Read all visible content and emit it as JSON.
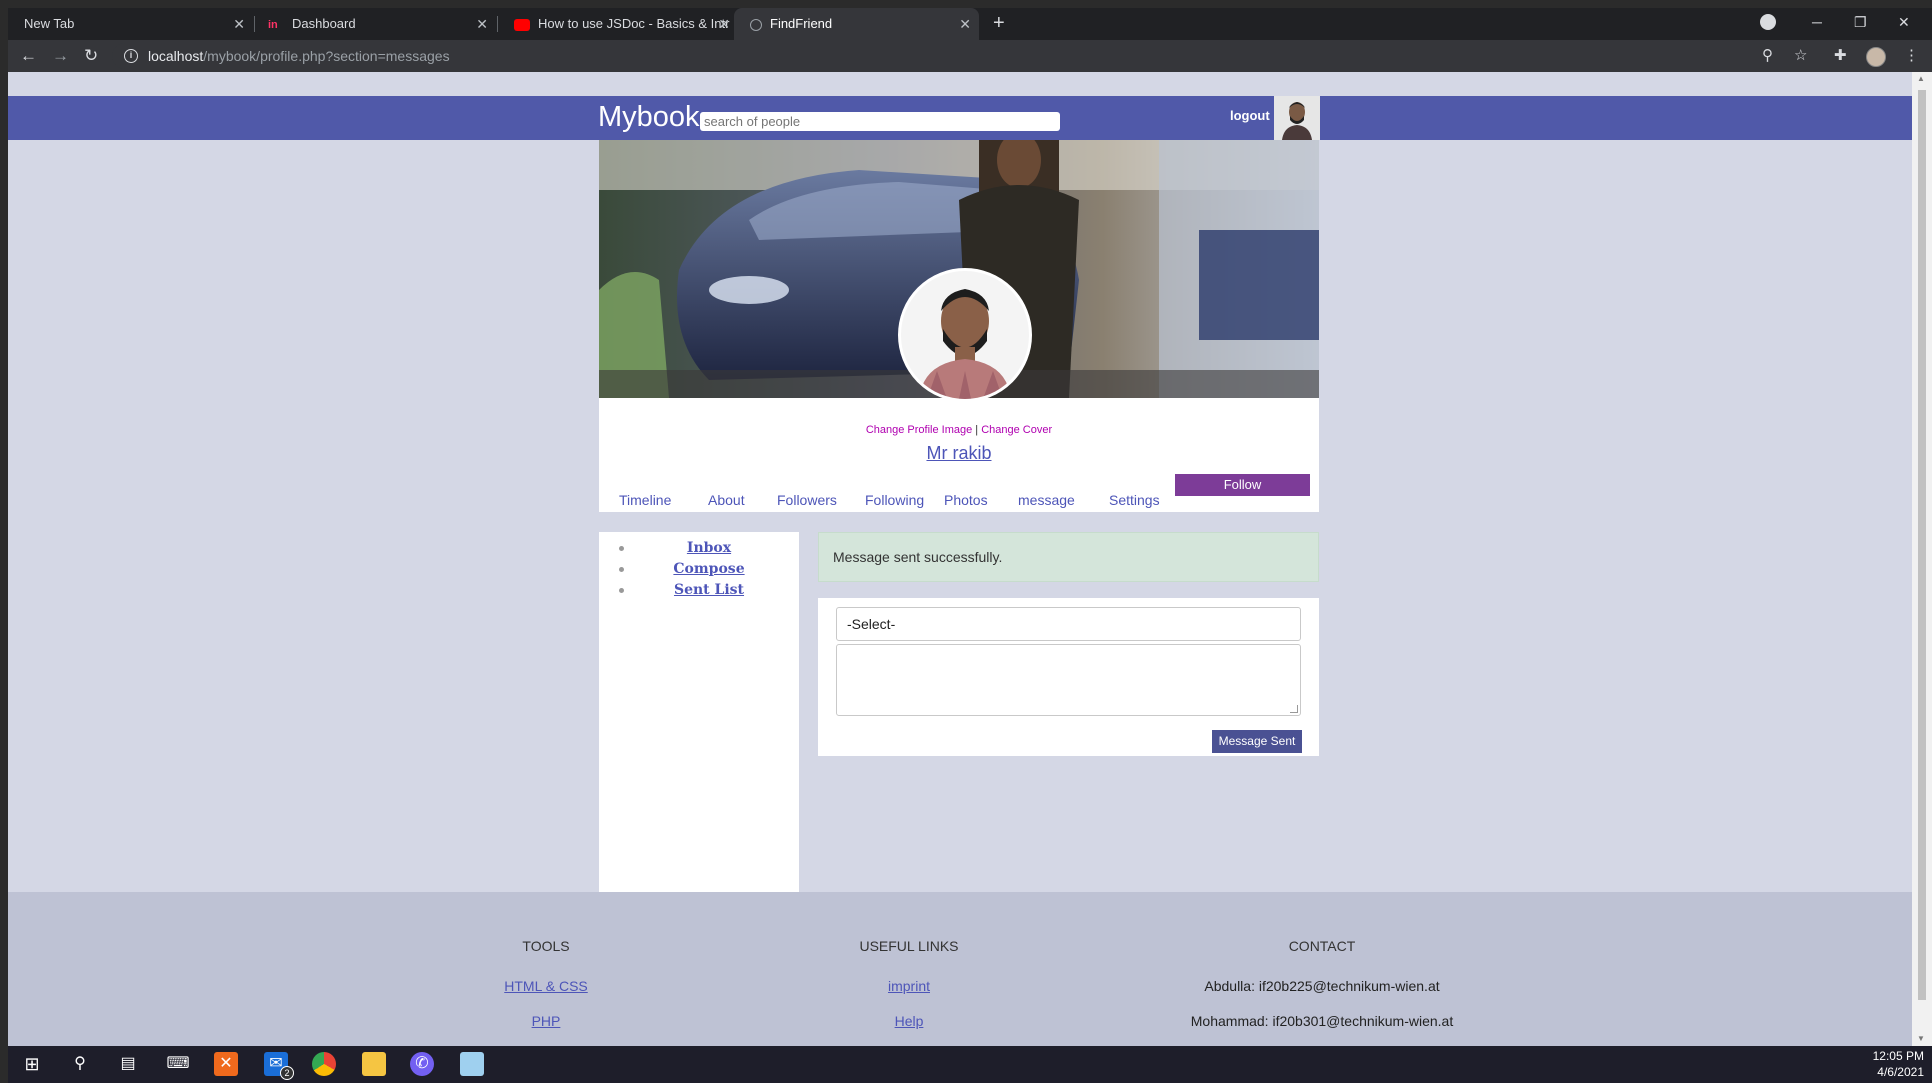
{
  "browser": {
    "tabs": [
      {
        "label": "New Tab"
      },
      {
        "label": "Dashboard"
      },
      {
        "label": "How to use JSDoc - Basics & Intr"
      },
      {
        "label": "FindFriend"
      }
    ],
    "url_host": "localhost",
    "url_path": "/mybook/profile.php?section=messages"
  },
  "header": {
    "brand": "Mybook",
    "search_placeholder": "search of people",
    "logout": "logout"
  },
  "profile": {
    "change_image": "Change Profile Image",
    "separator": "|",
    "change_cover": "Change Cover",
    "name": "Mr rakib",
    "follow": "Follow",
    "nav": [
      "Timeline",
      "About",
      "Followers",
      "Following",
      "Photos",
      "message",
      "Settings"
    ]
  },
  "messages": {
    "menu": [
      "Inbox",
      "Compose",
      "Sent List"
    ],
    "alert": "Message sent successfully.",
    "select_value": "-Select-",
    "send_button": "Message Sent"
  },
  "footer": {
    "tools_title": "TOOLS",
    "tools": [
      "HTML & CSS",
      "PHP"
    ],
    "links_title": "USEFUL LINKS",
    "links": [
      "imprint",
      "Help"
    ],
    "contact_title": "CONTACT",
    "contacts": [
      "Abdulla: if20b225@technikum-wien.at",
      "Mohammad: if20b301@technikum-wien.at"
    ]
  },
  "taskbar": {
    "time": "12:05 PM",
    "date": "4/6/2021",
    "mail_badge": "2"
  }
}
